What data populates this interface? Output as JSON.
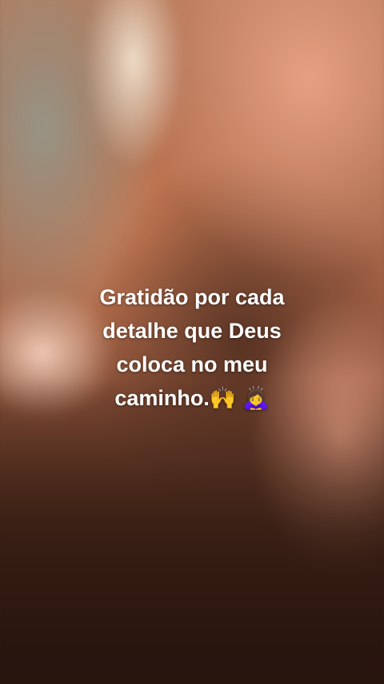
{
  "story": {
    "caption_lines": [
      "Gratidão por cada",
      "detalhe que Deus",
      "coloca no meu",
      "caminho.🙌 🙇‍♀️"
    ]
  }
}
